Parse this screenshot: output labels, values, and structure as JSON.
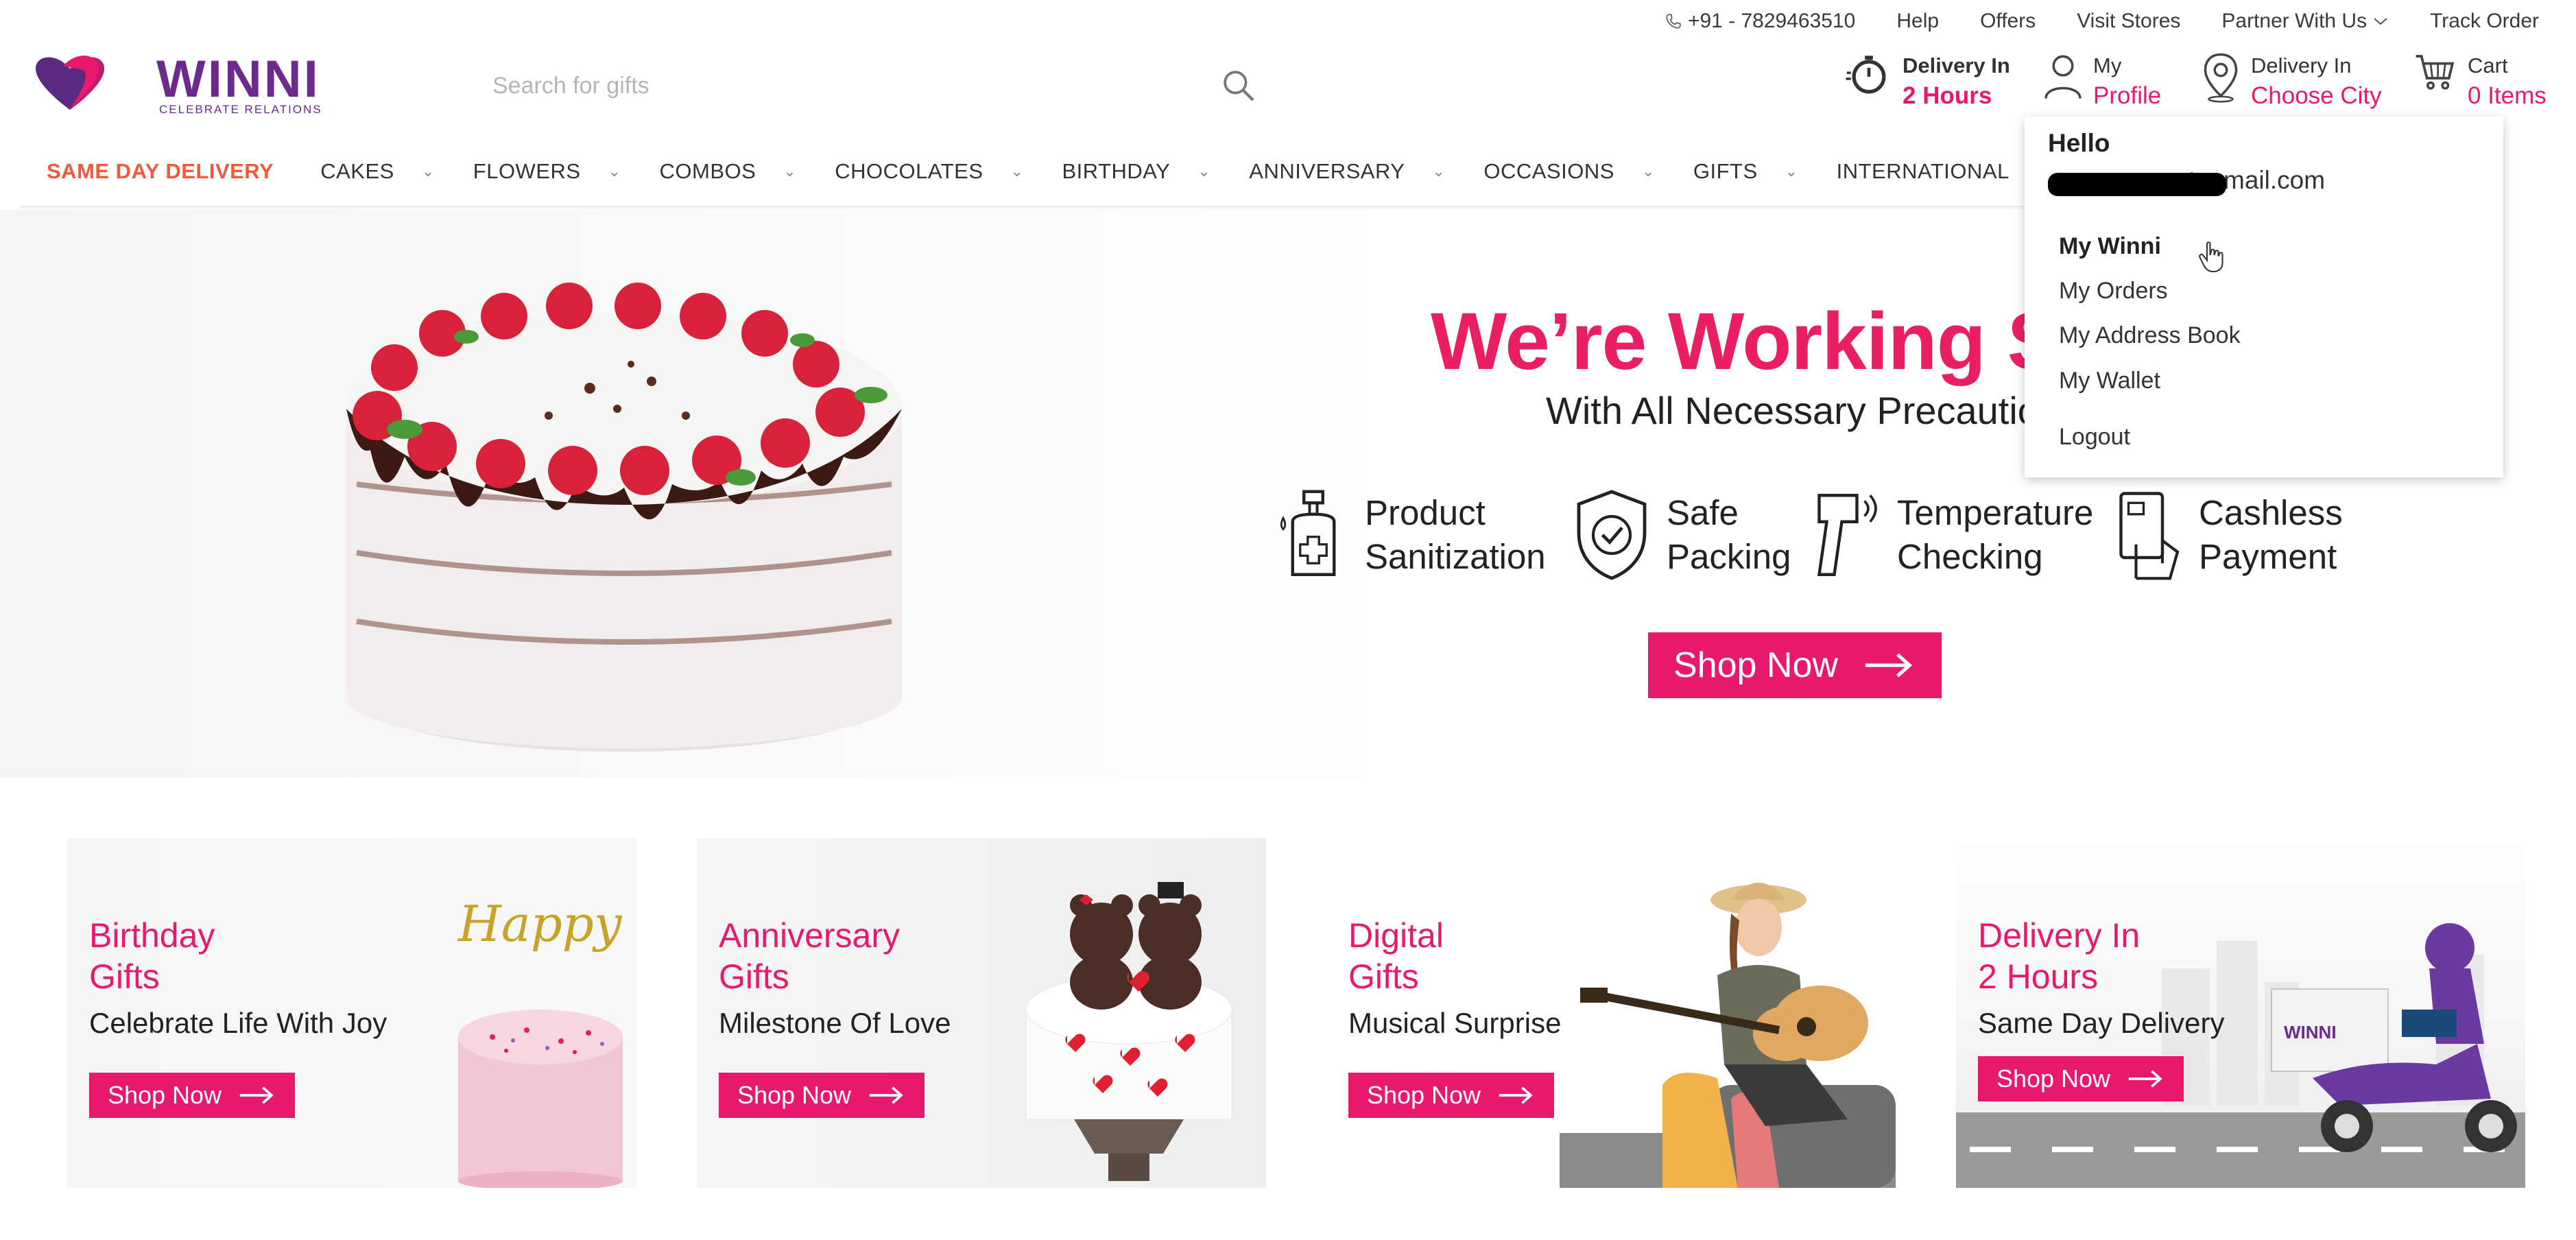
{
  "topbar": {
    "phone": "+91 - 7829463510",
    "help": "Help",
    "offers": "Offers",
    "visit_stores": "Visit Stores",
    "partner": "Partner With Us",
    "track_order": "Track Order"
  },
  "brand": {
    "name": "WINNI",
    "tagline": "CELEBRATE RELATIONS"
  },
  "search": {
    "placeholder": "Search for gifts"
  },
  "header": {
    "delivery_time": {
      "line1": "Delivery In",
      "line2": "2 Hours"
    },
    "profile": {
      "line1": "My",
      "line2": "Profile"
    },
    "city": {
      "line1": "Delivery In",
      "line2": "Choose City"
    },
    "cart": {
      "line1": "Cart",
      "line2": "0 Items"
    }
  },
  "nav": [
    {
      "label": "SAME DAY DELIVERY"
    },
    {
      "label": "CAKES"
    },
    {
      "label": "FLOWERS"
    },
    {
      "label": "COMBOS"
    },
    {
      "label": "CHOCOLATES"
    },
    {
      "label": "BIRTHDAY"
    },
    {
      "label": "ANNIVERSARY"
    },
    {
      "label": "OCCASIONS"
    },
    {
      "label": "GIFTS"
    },
    {
      "label": "INTERNATIONAL"
    }
  ],
  "dropdown": {
    "hello": "Hello",
    "email_visible": "otonmail.com",
    "items": [
      "My Winni",
      "My Orders",
      "My Address Book",
      "My Wallet",
      "Logout"
    ]
  },
  "hero": {
    "title": "We’re Working Sa",
    "subtitle": "With All Necessary Precaution",
    "features": [
      {
        "l1": "Product",
        "l2": "Sanitization"
      },
      {
        "l1": "Safe",
        "l2": "Packing"
      },
      {
        "l1": "Temperature",
        "l2": "Checking"
      },
      {
        "l1": "Cashless",
        "l2": "Payment"
      }
    ],
    "cta": "Shop Now"
  },
  "cards": [
    {
      "t1": "Birthday",
      "t2": "Gifts",
      "sub": "Celebrate Life With Joy",
      "cta": "Shop Now",
      "cake_text": "Happy Birthday"
    },
    {
      "t1": "Anniversary",
      "t2": "Gifts",
      "sub": "Milestone Of Love",
      "cta": "Shop Now"
    },
    {
      "t1": "Digital",
      "t2": "Gifts",
      "sub": "Musical Surprise",
      "cta": "Shop Now"
    },
    {
      "t1": "Delivery In",
      "t2": "2 Hours",
      "sub": "Same Day Delivery",
      "cta": "Shop Now",
      "scooter_text": "WINNI"
    }
  ],
  "colors": {
    "brand_pink": "#e8196c",
    "same_day_orange": "#f2593a",
    "logo_purple": "#6b2a8c"
  }
}
